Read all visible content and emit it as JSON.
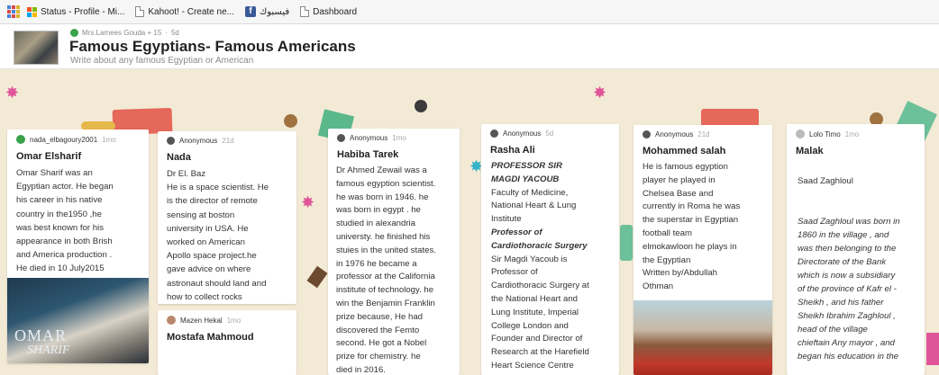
{
  "bookmarks": [
    {
      "label": "Status - Profile - Mi...",
      "icon": "microsoft-icon"
    },
    {
      "label": "Kahoot! - Create ne...",
      "icon": "page-icon"
    },
    {
      "label": "فيسبوك",
      "icon": "facebook-icon"
    },
    {
      "label": "Dashboard",
      "icon": "page-icon"
    }
  ],
  "header": {
    "author": "Mrs.Lamees Gouda + 15",
    "time": "5d",
    "title": "Famous Egyptians- Famous Americans",
    "subtitle": "Write about any famous Egyptian or American"
  },
  "posts": [
    {
      "author": "nada_elbagoury2001",
      "time": "1mo",
      "title": "Omar Elsharif",
      "lines": [
        "Omar Sharif was an",
        "Egyptian actor. He began",
        "his career in his native",
        "country in the1950 ,he",
        "was best known for his",
        "appearance in both Brish",
        "and America production .",
        "He died in 10 July2015"
      ],
      "image_text_1": "OMAR",
      "image_text_2": "SHARIF"
    },
    {
      "author": "Anonymous",
      "time": "21d",
      "title": "Nada",
      "lines": [
        "Dr El. Baz",
        "He is a space scientist. He",
        "is the director of remote",
        "sensing at boston",
        "university in USA. He",
        "worked on American",
        "Apollo space project.he",
        "gave advice on where",
        "astronaut should land and",
        "how to collect rocks"
      ]
    },
    {
      "author": "Mazen Hekal",
      "time": "1mo",
      "title": "Mostafa Mahmoud"
    },
    {
      "author": "Anonymous",
      "time": "1mo",
      "title": "Habiba Tarek",
      "lines": [
        "Dr Ahmed Zewail was a",
        "famous egyption scientist.",
        "he was born in 1946. he",
        "was born in egypt . he",
        "studied in alexandria",
        "universty. he finished his",
        "stuies in the united states.",
        "in 1976 he became a",
        "professor at the California",
        "institute of technology. he",
        "win the Benjamin Franklin",
        "prize because, He had",
        "discovered the Femto",
        "second. He got a Nobel",
        "prize for chemistry. he",
        "died in 2016."
      ]
    },
    {
      "author": "Anonymous",
      "time": "5d",
      "title": "Rasha Ali",
      "heading_1": "PROFESSOR SIR",
      "heading_2": "MAGDI YACOUB",
      "lines_a": [
        "Faculty of Medicine,",
        "National Heart & Lung",
        "Institute"
      ],
      "heading_3": "Professor of",
      "heading_4": "Cardiothoracic Surgery",
      "lines_b": [
        " Sir Magdi Yacoub is",
        "Professor of",
        "Cardiothoracic Surgery at",
        "the National Heart and",
        "Lung Institute, Imperial",
        "College London and",
        "Founder and Director of",
        "Research at the Harefield",
        "Heart Science Centre"
      ]
    },
    {
      "author": "Anonymous",
      "time": "21d",
      "title": "Mohammed salah",
      "lines": [
        " He is famous egyption",
        "player he played in",
        "Chelsea Base and",
        "currently in Roma he was",
        "the superstar in Egyptian",
        "football team",
        "elmokawloon he plays in",
        "the Egyptian",
        "Written by/Abdullah",
        "Othman"
      ]
    },
    {
      "author": "Lolo Timo",
      "time": "1mo",
      "title": "Malak",
      "first_line": "Saad Zaghloul",
      "lines": [
        "Saad Zaghloul was born in",
        "1860 in the village , and",
        "was then belonging to the",
        "Directorate of the Bank",
        "which is now a subsidiary",
        "of the province of Kafr el -",
        "Sheikh , and his father",
        "Sheikh Ibrahim Zaghloul ,",
        "head of the village",
        "chieftain Any mayor , and",
        "began his education in the"
      ]
    }
  ]
}
